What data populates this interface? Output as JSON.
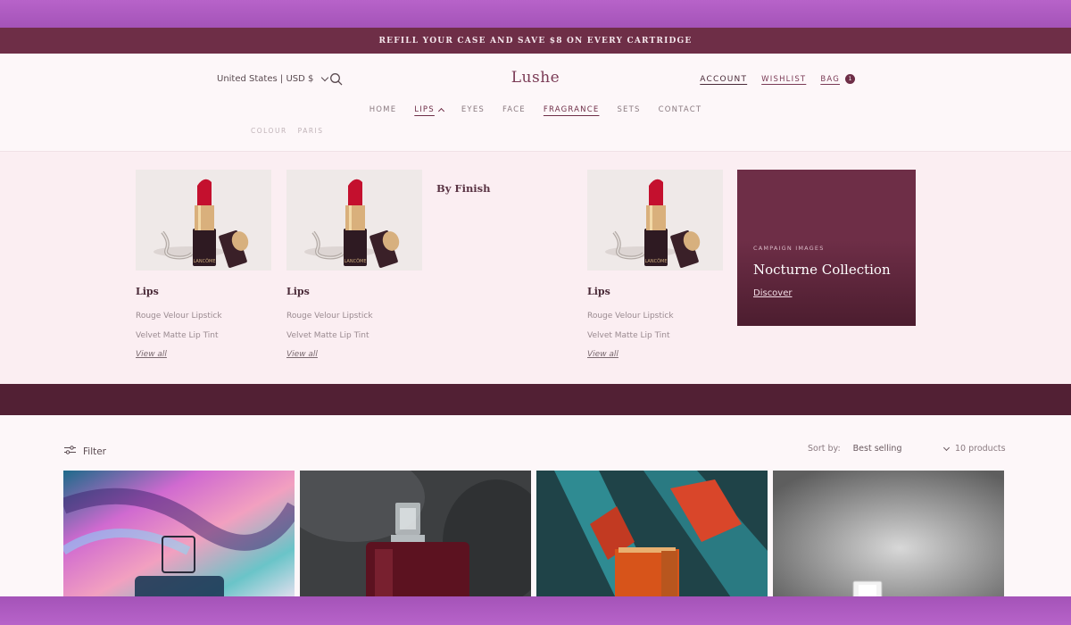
{
  "announcement": "REFILL YOUR CASE AND SAVE $8 ON EVERY CARTRIDGE",
  "header": {
    "country": "United States | USD $",
    "logo": "Lushe",
    "account": "ACCOUNT",
    "wishlist": "WISHLIST",
    "bag": "BAG",
    "bag_count": "1"
  },
  "nav": {
    "items": [
      "HOME",
      "LIPS",
      "EYES",
      "FACE",
      "FRAGRANCE",
      "SETS",
      "CONTACT"
    ],
    "sub_items": [
      "COLOUR",
      "PARIS"
    ]
  },
  "mega_menu": {
    "columns": [
      {
        "heading": "Lips",
        "links": [
          "Rouge Velour Lipstick",
          "Velvet Matte Lip Tint"
        ],
        "view_all": "View all"
      },
      {
        "heading": "Lips",
        "links": [
          "Rouge Velour Lipstick",
          "Velvet Matte Lip Tint"
        ],
        "view_all": "View all"
      },
      {
        "heading": "Lips",
        "links": [
          "Rouge Velour Lipstick",
          "Velvet Matte Lip Tint"
        ],
        "view_all": "View all"
      }
    ],
    "by_finish": "By Finish",
    "lipstick_brand": "LANCÔME",
    "promo": {
      "eyebrow": "CAMPAIGN IMAGES",
      "title": "Nocturne Collection",
      "cta": "Discover"
    }
  },
  "collection": {
    "filter": "Filter",
    "sort_label": "Sort by:",
    "sort_value": "Best selling",
    "product_count": "10 products"
  },
  "colors": {
    "brand": "#6e2e47",
    "band": "#522034",
    "page_bg": "#fdf7f9",
    "mega_bg": "#fbeef2",
    "frame": "#b85fcb"
  }
}
